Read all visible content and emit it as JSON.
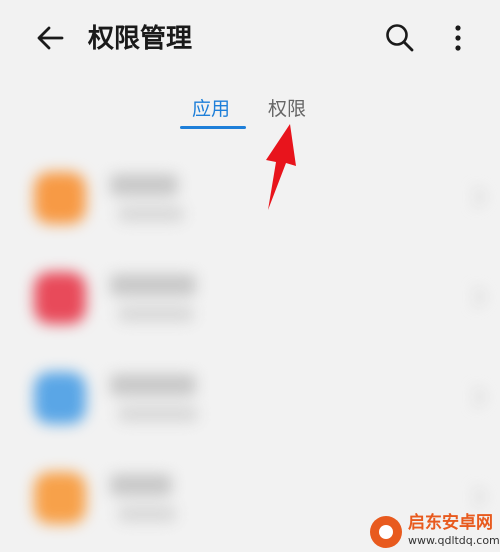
{
  "header": {
    "title": "权限管理"
  },
  "tabs": [
    {
      "label": "应用",
      "active": true
    },
    {
      "label": "权限",
      "active": false
    }
  ],
  "apps": [
    {
      "icon_color": "#f79a45"
    },
    {
      "icon_color": "#e84a5a"
    },
    {
      "icon_color": "#5aa6e6"
    },
    {
      "icon_color": "#f7a14a"
    }
  ],
  "watermark": {
    "name": "启东安卓网",
    "url": "www.qdltdq.com"
  },
  "colors": {
    "accent": "#1e7fd9",
    "arrow": "#e8141c"
  }
}
